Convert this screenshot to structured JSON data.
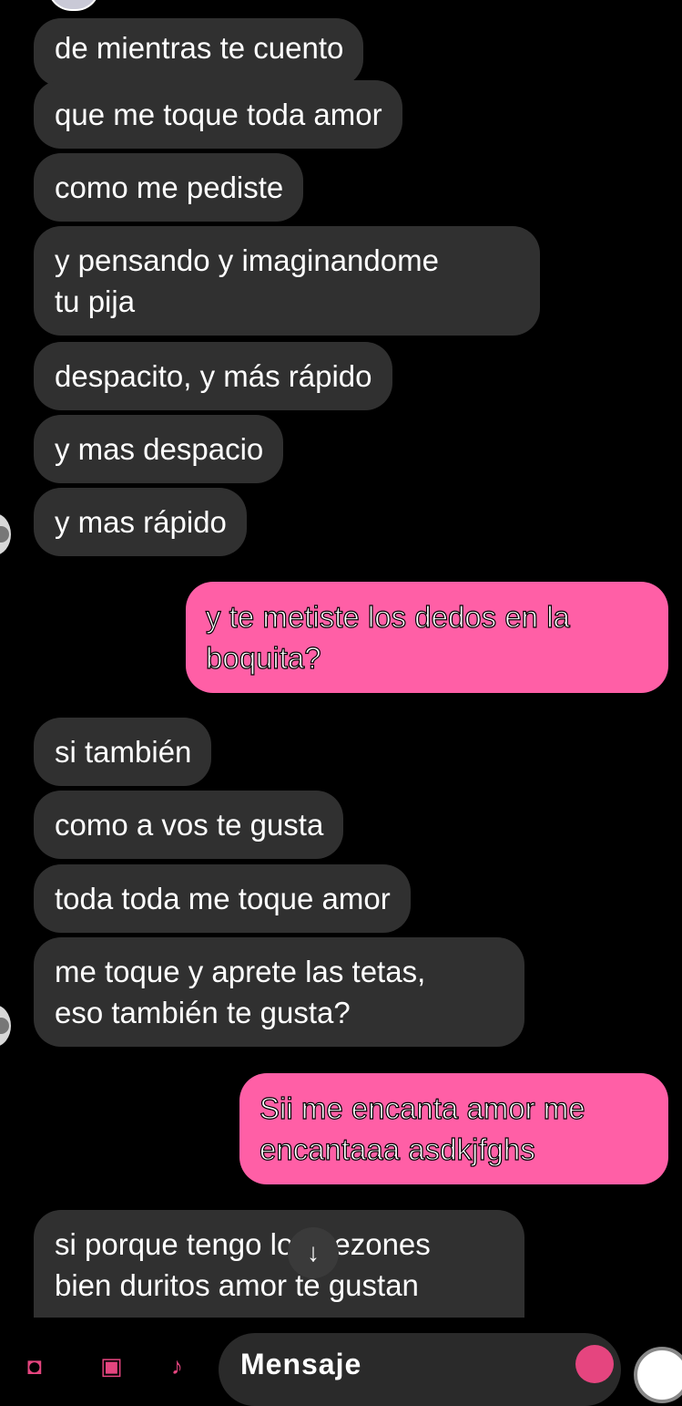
{
  "messages": [
    {
      "text": "de mientras te cuento"
    },
    {
      "text": "que me toque toda amor"
    },
    {
      "text": "como me pediste"
    },
    {
      "text": "y pensando y imaginandome\ntu pija"
    },
    {
      "text": "despacito, y más rápido"
    },
    {
      "text": "y mas despacio"
    },
    {
      "text": "y mas rápido"
    },
    {
      "text": "y te metiste los dedos en la\nboquita?"
    },
    {
      "text": "si también"
    },
    {
      "text": "como a vos te gusta"
    },
    {
      "text": "toda toda me toque amor"
    },
    {
      "text": "me toque y aprete las tetas,\neso también te gusta?"
    },
    {
      "text": "Sii me encanta amor me\nencantaaa asdkjfghs"
    },
    {
      "text": "si porque tengo los pezones\nbien duritos amor te gustan"
    }
  ],
  "scroll_button": {
    "icon": "arrow-down-icon",
    "glyph": "↓"
  },
  "composer": {
    "placeholder": "Mensaje",
    "icons": [
      "camera-icon",
      "gallery-icon",
      "microphone-icon",
      "sticker-icon"
    ]
  },
  "colors": {
    "sent_bubble": "#ff5fa6",
    "received_bubble": "#303030",
    "accent": "#e5457f"
  }
}
